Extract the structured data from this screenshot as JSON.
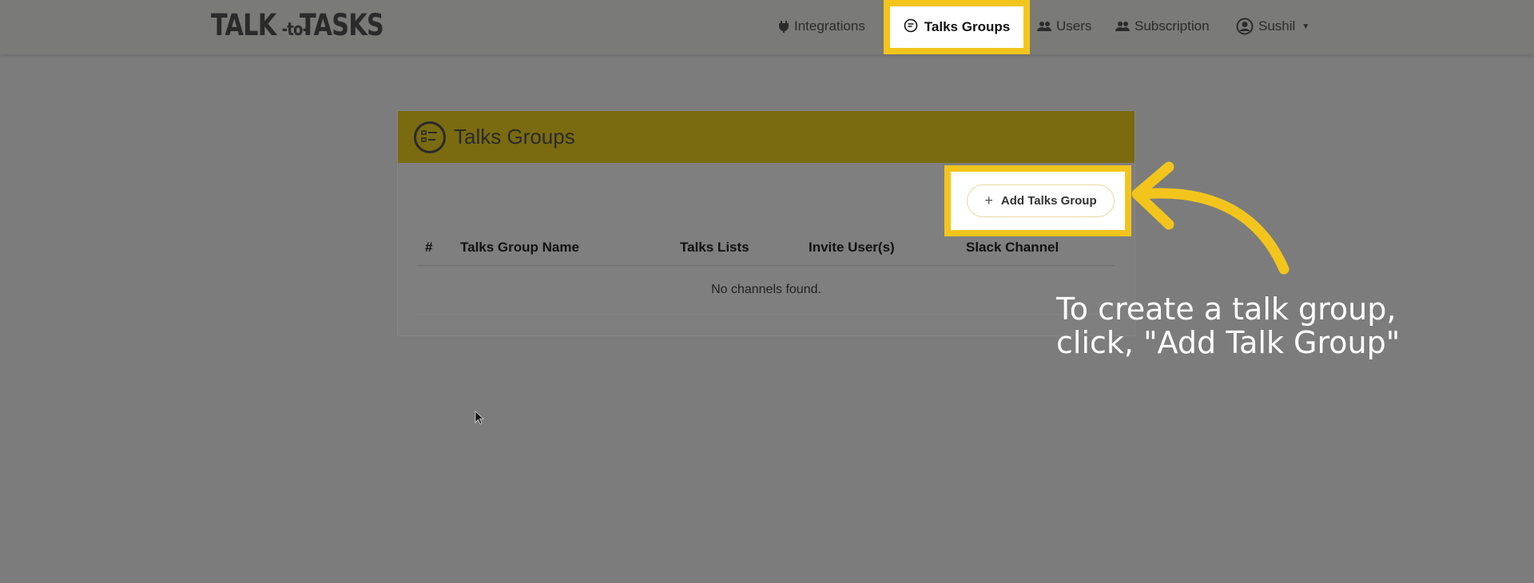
{
  "brand": {
    "part1": "TALK",
    "part2": "-to-",
    "part3": "TASKS"
  },
  "nav": {
    "integrations": {
      "label": "Integrations",
      "icon": "plug-icon"
    },
    "talks_groups": {
      "label": "Talks Groups",
      "icon": "chat-bubble-icon",
      "active": true
    },
    "users": {
      "label": "Users",
      "icon": "users-icon"
    },
    "subscription": {
      "label": "Subscription",
      "icon": "users-icon"
    },
    "user_menu": {
      "label": "Sushil",
      "icon": "user-circle-icon"
    }
  },
  "card": {
    "title": "Talks Groups",
    "add_button_label": "Add Talks Group",
    "table": {
      "columns": [
        "#",
        "Talks Group Name",
        "Talks Lists",
        "Invite User(s)",
        "Slack Channel"
      ],
      "rows": [],
      "empty_message": "No channels found."
    }
  },
  "annotation": {
    "line1": "To create a talk group,",
    "line2": "click, \"Add Talk Group\""
  },
  "colors": {
    "highlight": "#f3c51c",
    "card_header": "#7a6b10",
    "overlay_bg": "#7c7c7c"
  }
}
